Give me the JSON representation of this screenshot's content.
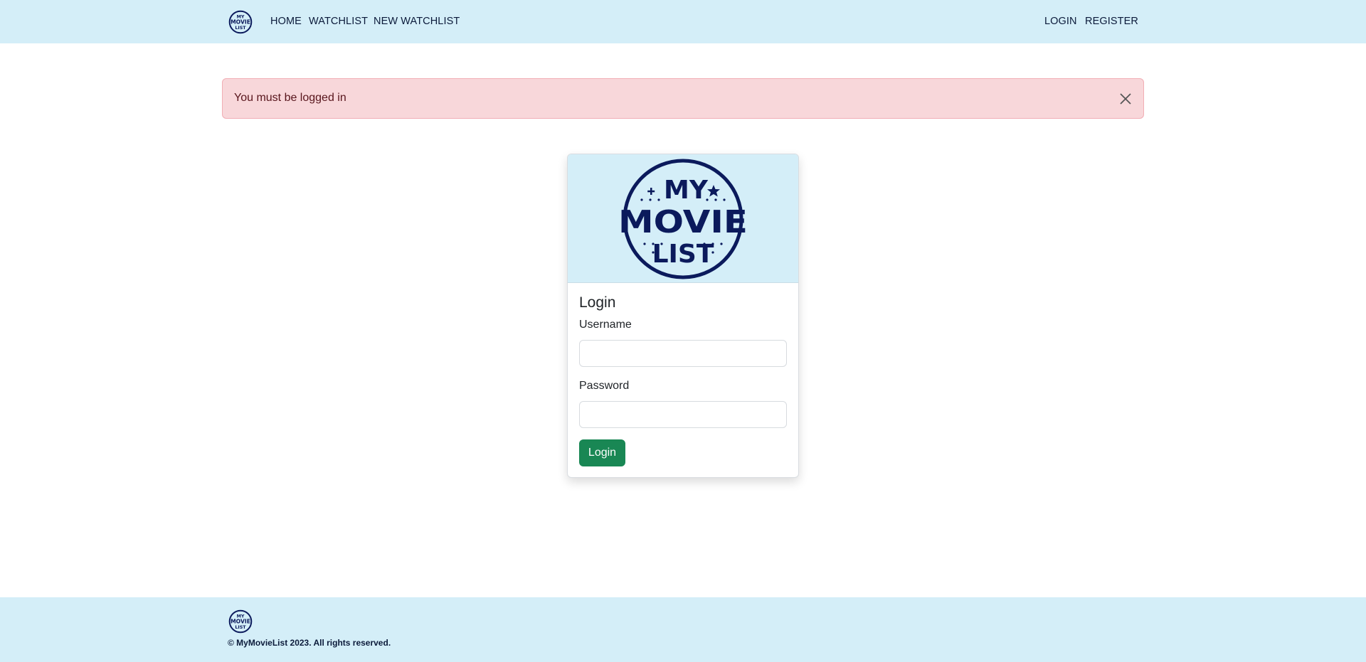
{
  "nav": {
    "logo": {
      "line1": "MY",
      "line2": "MOVIE",
      "line3": "LIST"
    },
    "links": [
      "HOME",
      "WATCHLIST",
      "NEW WATCHLIST"
    ],
    "right_links": [
      "LOGIN",
      "REGISTER"
    ]
  },
  "alert": {
    "message": "You must be logged in",
    "close_icon": "close-icon"
  },
  "login_card": {
    "logo": {
      "line1": "MY",
      "line2": "MOVIE",
      "line3": "LIST"
    },
    "title": "Login",
    "username_label": "Username",
    "username_value": "",
    "password_label": "Password",
    "password_value": "",
    "submit_label": "Login"
  },
  "footer": {
    "copyright": "© MyMovieList 2023. All rights reserved."
  },
  "colors": {
    "header_bg": "#d4eef8",
    "brand_navy": "#0b1a5c",
    "alert_bg": "#f8d7da",
    "alert_text": "#58151c",
    "success": "#198754"
  }
}
